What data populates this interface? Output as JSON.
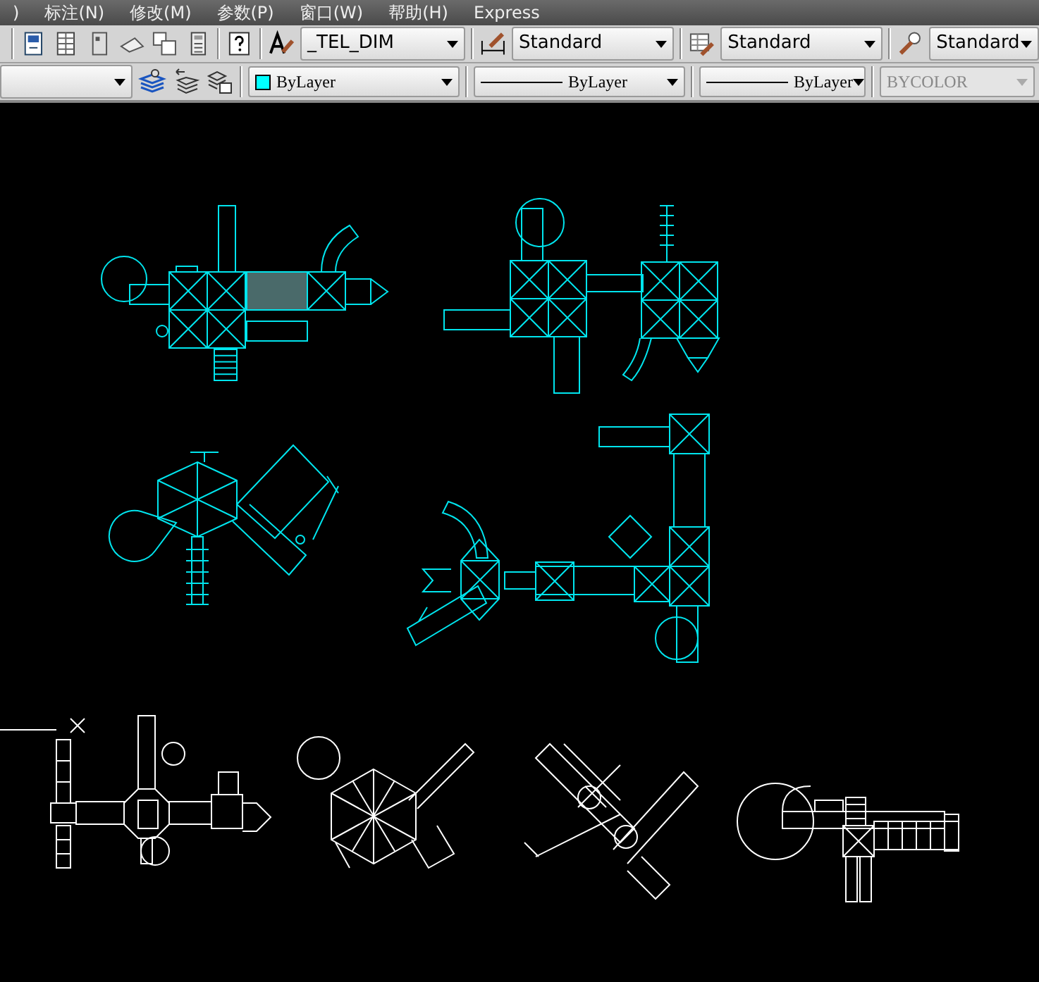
{
  "menu_bar": {
    "items": [
      ")",
      "标注(N)",
      "修改(M)",
      "参数(P)",
      "窗口(W)",
      "帮助(H)",
      "Express"
    ]
  },
  "styles_toolbar": {
    "text_style": "_TEL_DIM",
    "dimension_style": "Standard",
    "table_style": "Standard",
    "multileader_style": "Standard"
  },
  "properties_toolbar": {
    "color": {
      "label": "ByLayer",
      "color": "#00ffff"
    },
    "linetype": "ByLayer",
    "lineweight": "ByLayer",
    "plot_style": {
      "label": "BYCOLOR",
      "disabled": true
    }
  }
}
